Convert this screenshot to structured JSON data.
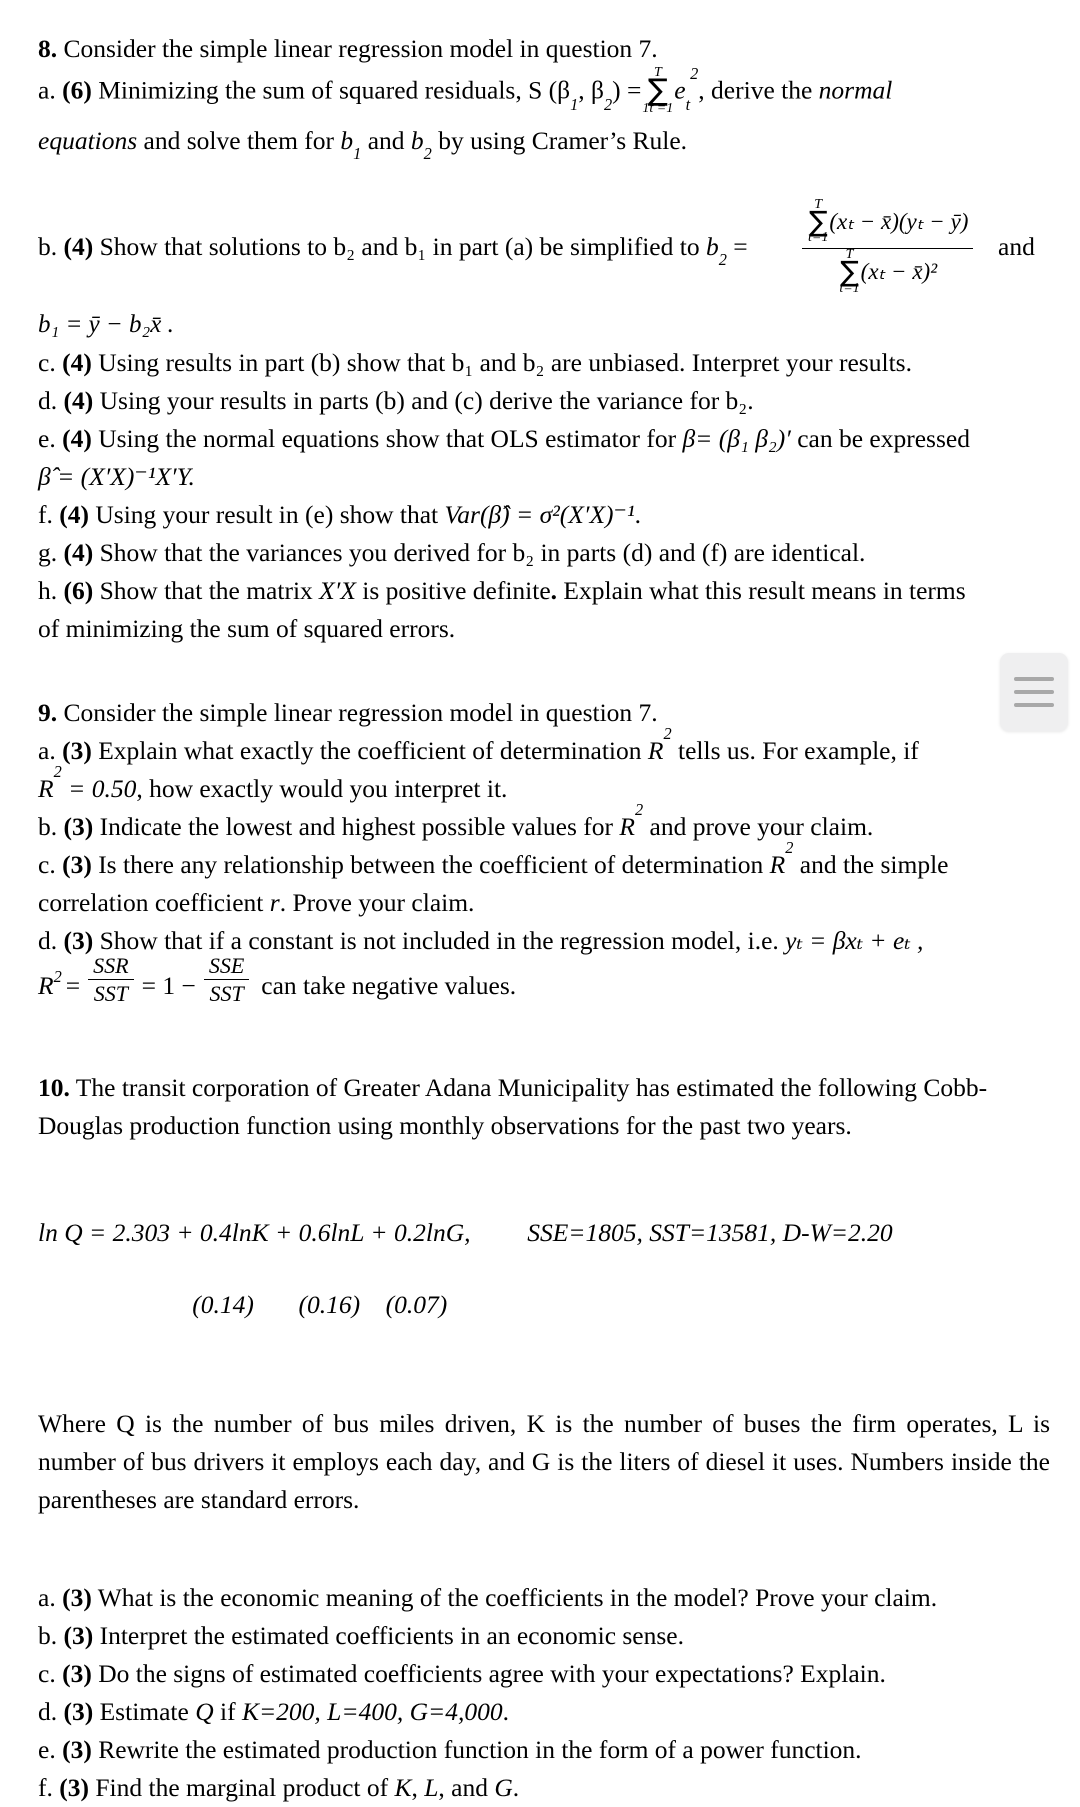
{
  "document": {
    "questions": [
      {
        "number": "8.",
        "stem": "Consider the simple linear regression model in question 7.",
        "parts": {
          "a": {
            "label": "a.",
            "points": "(6)",
            "text_before": "Minimizing the sum of squared residuals, S (",
            "beta1": "β",
            "beta1_sub": "1",
            "beta2": "β",
            "beta2_sub": "2",
            "text_mid": ") =",
            "sum_upper": "T",
            "sum_lower": "1t =1",
            "summand": "e",
            "summand_sub": "t",
            "summand_sup": "2",
            "text_after": ", derive the",
            "emph": "normal",
            "line2_emph": "equations",
            "line2_text": "and solve them for",
            "line2_b1": "b",
            "line2_b1_sub": "1",
            "line2_and": "and",
            "line2_b2": "b",
            "line2_b2_sub": "2",
            "line2_tail": "by using Cramer’s Rule."
          },
          "b": {
            "label": "b.",
            "points": "(4)",
            "lead": "Show that solutions to b₂ and b₁ in part (a) be simplified to",
            "lhs": "b",
            "lhs_sub": "2",
            "equals": "=",
            "numerator_sum_upper": "T",
            "numerator_sum_lower": "t=1",
            "numerator_body": "(xₜ − x̄)(yₜ − ȳ)",
            "denominator_sum_upper": "T",
            "denominator_sum_lower": "t=1",
            "denominator_body": "(xₜ − x̄)²",
            "and": "and",
            "b1_formula": "b₁ = ȳ − b₂x̄ ."
          },
          "c": {
            "label": "c.",
            "points": "(4)",
            "text": "Using results in part (b) show that b₁ and b₂ are unbiased. Interpret your results."
          },
          "d": {
            "label": "d.",
            "points": "(4)",
            "text": "Using your results in parts (b) and (c) derive the variance for b₂."
          },
          "e": {
            "label": "e.",
            "points": "(4)",
            "text_before": "Using the normal equations show that OLS estimator for",
            "beta_def": "β= (β₁ β₂)′",
            "text_after": "can be expressed",
            "line2": "β̂ = (X′X)⁻¹X′Y."
          },
          "f": {
            "label": "f.",
            "points": "(4)",
            "text_before": "Using your result in (e) show that",
            "formula": "Var(β̂) = σ²(X′X)⁻¹",
            "text_after": "."
          },
          "g": {
            "label": "g.",
            "points": "(4)",
            "text": "Show that the variances you derived for b₂ in parts (d) and (f) are identical."
          },
          "h": {
            "label": "h.",
            "points": "(6)",
            "text_before": "Show that the matrix",
            "matrix": "X′X",
            "text_after": "is positive definite",
            "bold_period": ".",
            "text_tail": "Explain what this result means in terms",
            "line2": "of minimizing the sum of squared errors."
          }
        }
      },
      {
        "number": "9.",
        "stem": "Consider the simple linear regression model in question 7.",
        "parts": {
          "a": {
            "label": "a.",
            "points": "(3)",
            "text_before": "Explain what exactly the coefficient of determination",
            "r2": "R",
            "r2_sup": "2",
            "text_after": "tells us.  For example, if",
            "line2_r2": "R",
            "line2_r2_sup": "2",
            "line2_value": "= 0.50",
            "line2_tail": ", how exactly would you interpret it."
          },
          "b": {
            "label": "b.",
            "points": "(3)",
            "text_before": "Indicate the lowest and highest possible values for",
            "r2": "R",
            "r2_sup": "2",
            "text_after": "and prove your claim."
          },
          "c": {
            "label": "c.",
            "points": "(3)",
            "text_before": "Is there any relationship between the coefficient of determination",
            "r2": "R",
            "r2_sup": "2",
            "text_after": "and the simple",
            "line2_before": "correlation coefficient",
            "r_symbol": "r",
            "line2_after": ".  Prove your claim."
          },
          "d": {
            "label": "d.",
            "points": "(3)",
            "text_before": "Show that if a constant is not included in the regression model, i.e.",
            "model": "yₜ =  βxₜ + eₜ ,",
            "r2_lhs": "R",
            "r2_lhs_sup": "2",
            "eq1": "=",
            "frac1_num": "SSR",
            "frac1_den": "SST",
            "eq2": "= 1 −",
            "frac2_num": "SSE",
            "frac2_den": "SST",
            "tail": "can take negative values."
          }
        }
      },
      {
        "number": "10.",
        "stem_line1": "The transit corporation of Greater Adana Municipality has estimated the following Cobb-",
        "stem_line2": "Douglas production function using monthly observations for the past two years.",
        "equation": {
          "main": "ln Q = 2.303 +  0.4lnK + 0.6lnL + 0.2lnG,",
          "stats": "SSE=1805, SST=13581, D-W=2.20",
          "std_errors": "(0.14)       (0.16)    (0.07)"
        },
        "definition_paragraph": "Where Q is the number of bus miles driven, K is the number of buses the firm operates, L is number of bus drivers it employs each day, and G is the liters of diesel it uses. Numbers inside the parentheses are standard errors.",
        "parts": {
          "a": {
            "label": "a.",
            "points": "(3)",
            "text": "What is the economic meaning of the coefficients in the model? Prove your claim."
          },
          "b": {
            "label": "b.",
            "points": "(3)",
            "text": "Interpret the estimated coefficients in an economic sense."
          },
          "c": {
            "label": "c.",
            "points": "(3)",
            "text": "Do the signs of estimated coefficients agree with your expectations? Explain."
          },
          "d": {
            "label": "d.",
            "points": "(3)",
            "text_before": "Estimate",
            "q": "Q",
            "text_mid": "if",
            "values": "K=200, L=400, G=4,000",
            "tail": "."
          },
          "e": {
            "label": "e.",
            "points": "(3)",
            "text": "Rewrite the estimated production function in the form of a power function."
          },
          "f": {
            "label": "f.",
            "points": "(3)",
            "text_before": "Find the marginal product of",
            "k": "K",
            "comma1": ",",
            "l": "L",
            "comma2": ", and",
            "g": "G",
            "tail": "."
          }
        }
      }
    ]
  },
  "overlay": {
    "menu_button": {
      "icon": "hamburger-menu-icon",
      "bar_color": "#a8a8a8",
      "background_color": "#efeff0"
    }
  }
}
